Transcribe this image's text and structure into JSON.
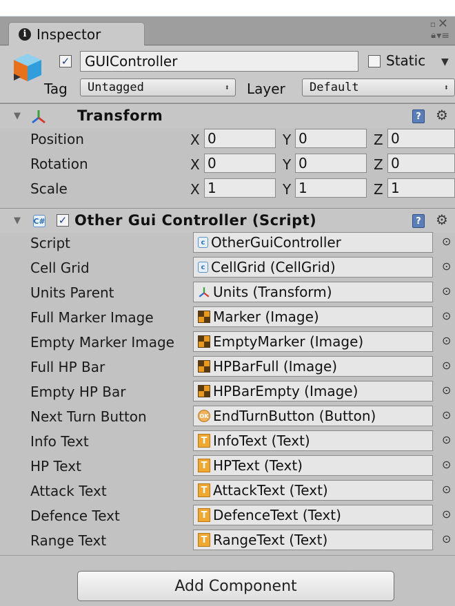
{
  "window": {
    "tab_label": "Inspector",
    "controls": {
      "minimize": "▫",
      "close": "✕",
      "lock": "🔒",
      "menu": "▾≡"
    }
  },
  "gameobject": {
    "active": true,
    "name": "GUIController",
    "static_label": "Static",
    "static_checked": false,
    "tag_label": "Tag",
    "tag_value": "Untagged",
    "layer_label": "Layer",
    "layer_value": "Default"
  },
  "transform": {
    "title": "Transform",
    "rows": [
      {
        "label": "Position",
        "x": "0",
        "y": "0",
        "z": "0"
      },
      {
        "label": "Rotation",
        "x": "0",
        "y": "0",
        "z": "0"
      },
      {
        "label": "Scale",
        "x": "1",
        "y": "1",
        "z": "1"
      }
    ],
    "axis_labels": {
      "x": "X",
      "y": "Y",
      "z": "Z"
    }
  },
  "script_component": {
    "title": "Other Gui Controller (Script)",
    "enabled": true,
    "fields": [
      {
        "label": "Script",
        "value": "OtherGuiController",
        "icon": "script-icon"
      },
      {
        "label": "Cell Grid",
        "value": "CellGrid (CellGrid)",
        "icon": "script-icon"
      },
      {
        "label": "Units Parent",
        "value": "Units (Transform)",
        "icon": "transform-icon"
      },
      {
        "label": "Full Marker Image",
        "value": "Marker (Image)",
        "icon": "image-icon"
      },
      {
        "label": "Empty Marker Image",
        "value": "EmptyMarker (Image)",
        "icon": "image-icon"
      },
      {
        "label": "Full HP Bar",
        "value": "HPBarFull (Image)",
        "icon": "image-icon"
      },
      {
        "label": "Empty HP Bar",
        "value": "HPBarEmpty (Image)",
        "icon": "image-icon"
      },
      {
        "label": "Next Turn Button",
        "value": "EndTurnButton (Button)",
        "icon": "button-icon"
      },
      {
        "label": "Info Text",
        "value": "InfoText (Text)",
        "icon": "text-icon"
      },
      {
        "label": "HP Text",
        "value": "HPText (Text)",
        "icon": "text-icon"
      },
      {
        "label": "Attack Text",
        "value": "AttackText (Text)",
        "icon": "text-icon"
      },
      {
        "label": "Defence Text",
        "value": "DefenceText (Text)",
        "icon": "text-icon"
      },
      {
        "label": "Range Text",
        "value": "RangeText (Text)",
        "icon": "text-icon"
      }
    ]
  },
  "footer": {
    "add_component_label": "Add Component"
  },
  "colors": {
    "panel": "#c2c2c2",
    "tabbar": "#9e9e9e",
    "checkmark": "#1a3f8f",
    "help": "#5a7fb8"
  }
}
